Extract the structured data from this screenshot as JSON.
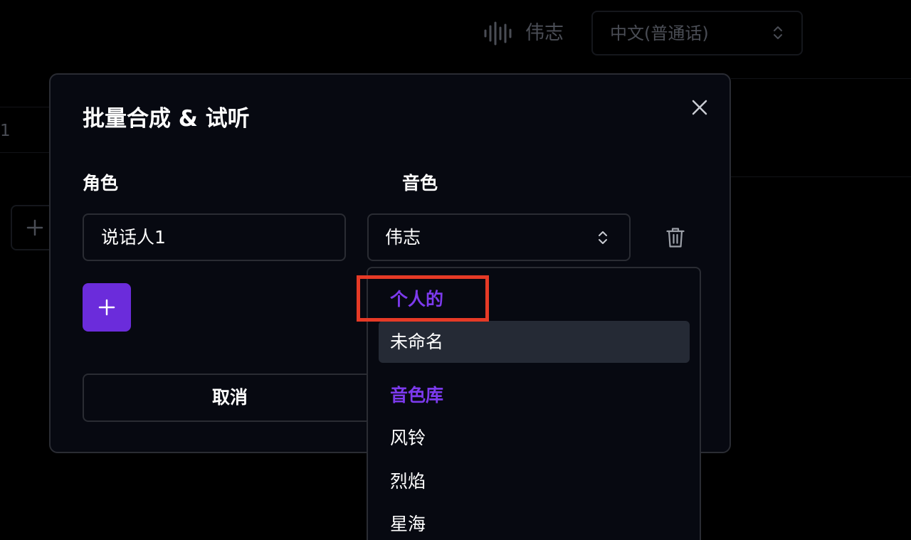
{
  "background": {
    "voice_name": "伟志",
    "language_select": "中文(普通话)",
    "row_label": "1"
  },
  "dialog": {
    "title": "批量合成 & 试听",
    "role_label": "角色",
    "voice_label": "音色",
    "role_value": "说话人1",
    "voice_value": "伟志",
    "cancel_label": "取消"
  },
  "dropdown": {
    "groups": [
      {
        "label": "个人的",
        "options": [
          "未命名"
        ]
      },
      {
        "label": "音色库",
        "options": [
          "风铃",
          "烈焰",
          "星海"
        ]
      }
    ],
    "highlighted_option": "未命名"
  },
  "colors": {
    "accent": "#6b2cdb",
    "group_label": "#7c3aed",
    "annotation": "#e63a26"
  },
  "icons": {
    "voice": "waveform-icon",
    "close": "close-icon",
    "delete": "trash-icon",
    "add": "plus-icon",
    "select": "chevron-up-down-icon"
  }
}
